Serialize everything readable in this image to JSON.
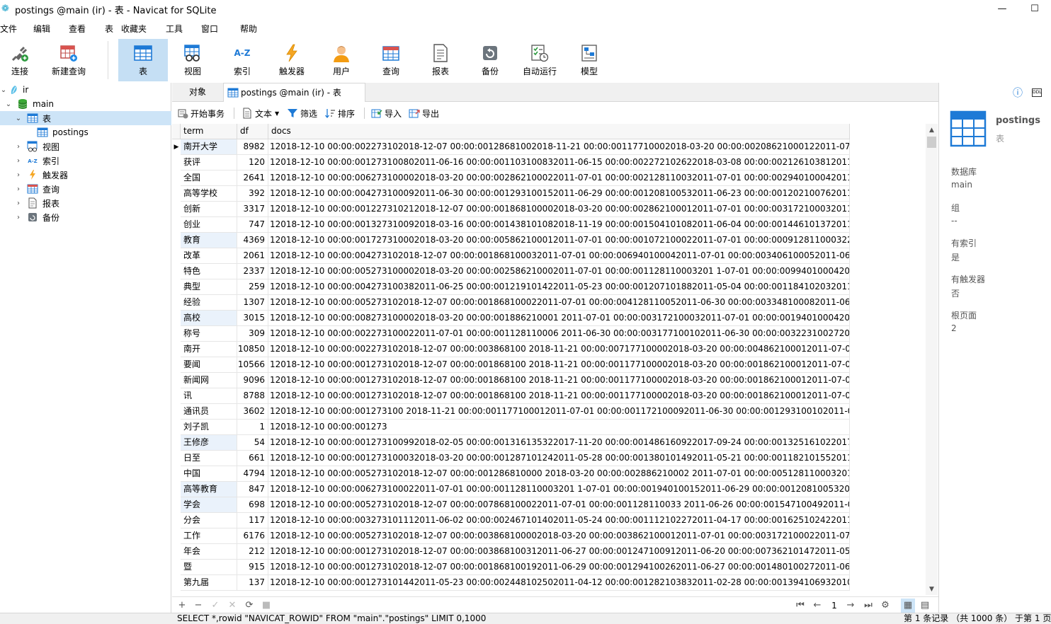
{
  "window": {
    "title": "postings @main (ir) - 表 - Navicat for SQLite",
    "minimize": "—",
    "maximize": "☐",
    "close": "✕"
  },
  "menu": [
    "文件",
    "编辑",
    "查看",
    "表",
    "收藏夹",
    "工具",
    "窗口",
    "帮助"
  ],
  "toolbar": {
    "items": [
      {
        "label": "连接",
        "icon": "connection-plug-icon"
      },
      {
        "label": "新建查询",
        "icon": "new-query-icon"
      },
      {
        "label": "表",
        "icon": "table-icon"
      },
      {
        "label": "视图",
        "icon": "view-glasses-icon"
      },
      {
        "label": "索引",
        "icon": "index-az-icon"
      },
      {
        "label": "触发器",
        "icon": "trigger-bolt-icon"
      },
      {
        "label": "用户",
        "icon": "user-icon"
      },
      {
        "label": "查询",
        "icon": "query-icon"
      },
      {
        "label": "报表",
        "icon": "report-icon"
      },
      {
        "label": "备份",
        "icon": "backup-icon"
      },
      {
        "label": "自动运行",
        "icon": "automation-icon"
      },
      {
        "label": "模型",
        "icon": "model-icon"
      }
    ]
  },
  "navigator": {
    "items": [
      {
        "label": "ir",
        "level": 0,
        "expanded": true
      },
      {
        "label": "main",
        "level": 1,
        "expanded": true
      },
      {
        "label": "表",
        "level": 2,
        "expanded": true,
        "selected": true
      },
      {
        "label": "postings",
        "level": 3
      },
      {
        "label": "视图",
        "level": 2
      },
      {
        "label": "索引",
        "level": 2
      },
      {
        "label": "触发器",
        "level": 2
      },
      {
        "label": "查询",
        "level": 2
      },
      {
        "label": "报表",
        "level": 2
      },
      {
        "label": "备份",
        "level": 2
      }
    ]
  },
  "tabs": {
    "objects": "对象",
    "active": "postings @main (ir) - 表"
  },
  "objtoolbar": {
    "begin_transaction": "开始事务",
    "text": "文本",
    "filter": "筛选",
    "sort": "排序",
    "import": "导入",
    "export": "导出"
  },
  "grid": {
    "columns": [
      "term",
      "df",
      "docs"
    ],
    "rows": [
      {
        "term": "南开大学",
        "df": "8982",
        "docs": "12018-12-10 00:00:002273102018-12-07 00:00:00128681002018-11-21 00:00:00117710002018-03-20 00:00:00208621000122011-07-01 00:00:00"
      },
      {
        "term": "获评",
        "df": "120",
        "docs": "12018-12-10 00:00:001273100802011-06-16 00:00:001103100832011-06-15 00:00:002272102622018-03-08 00:00:002126103812011-03-01 00:0"
      },
      {
        "term": "全国",
        "df": "2641",
        "docs": "12018-12-10 00:00:006273100002018-03-20 00:00:002862100022011-07-01 00:00:002128110032011-07-01 00:00:002940100042011-07-01 00:"
      },
      {
        "term": "高等学校",
        "df": "392",
        "docs": "12018-12-10 00:00:004273100092011-06-30 00:00:001293100152011-06-29 00:00:001208100532011-06-23 00:00:001202100762011-06-17 00:"
      },
      {
        "term": "创新",
        "df": "3317",
        "docs": "12018-12-10 00:00:001227310212018-12-07 00:00:001868100002018-03-20 00:00:002862100012011-07-01 00:00:003172100032011-07-01 00:00:0"
      },
      {
        "term": "创业",
        "df": "747",
        "docs": "12018-12-10 00:00:001327310092018-03-16 00:00:001438101082018-11-19 00:00:001504101082011-06-04 00:00:001446101372011-05-25 00:00"
      },
      {
        "term": "教育",
        "df": "4369",
        "docs": "12018-12-10 00:00:001727310002018-03-20 00:00:005862100012011-07-01 00:00:001072100022011-07-01 00:00:000912811000322011-07-01 0"
      },
      {
        "term": "改革",
        "df": "2061",
        "docs": "12018-12-10 00:00:004273102018-12-07 00:00:001868100032011-07-01 00:00:006940100042011-07-01 00:00:003406100052011-06-30 00:00:0"
      },
      {
        "term": "特色",
        "df": "2337",
        "docs": "12018-12-10 00:00:005273100002018-03-20 00:00:002586210002011-07-01 00:00:001128110003201 1-07-01 00:00:009940100042011-07-01 00"
      },
      {
        "term": "典型",
        "df": "259",
        "docs": "12018-12-10 00:00:004273100382011-06-25 00:00:001219101422011-05-23 00:00:001207101882011-05-04 00:00:001184102032011-04-26 00:"
      },
      {
        "term": "经验",
        "df": "1307",
        "docs": "12018-12-10 00:00:005273102018-12-07 00:00:001868100022011-07-01 00:00:004128110052011-06-30 00:00:003348100082011-06-30 00:00"
      },
      {
        "term": "高校",
        "df": "3015",
        "docs": "12018-12-10 00:00:008273100002018-03-20 00:00:001886210001 2011-07-01 00:00:003172100032011-07-01 00:00:001940100042011-07-01 00:"
      },
      {
        "term": "称号",
        "df": "309",
        "docs": "12018-12-10 00:00:002273100022011-07-01 00:00:001128110006 2011-06-30 00:00:003177100102011-06-30 00:00:003223100272011-06-27 00"
      },
      {
        "term": "南开",
        "df": "10850",
        "docs": "12018-12-10 00:00:002273102018-12-07 00:00:003868100 2018-11-21 00:00:007177100002018-03-20 00:00:004862100012011-07-01 00:00:0031"
      },
      {
        "term": "要闻",
        "df": "10566",
        "docs": "12018-12-10 00:00:001273102018-12-07 00:00:001868100 2018-11-21 00:00:001177100002018-03-20 00:00:001862100012011-07-01 00:00:0011"
      },
      {
        "term": "新闻网",
        "df": "9096",
        "docs": "12018-12-10 00:00:001273102018-12-07 00:00:001868100 2018-11-21 00:00:001177100002018-03-20 00:00:001862100012011-07-01 00:00:0011"
      },
      {
        "term": "讯",
        "df": "8788",
        "docs": "12018-12-10 00:00:001273102018-12-07 00:00:001868100 2018-11-21 00:00:001177100002018-03-20 00:00:001862100012011-07-01 00:00:0011"
      },
      {
        "term": "通讯员",
        "df": "3602",
        "docs": "12018-12-10 00:00:001273100 2018-11-21 00:00:001177100012011-07-01 00:00:001172100092011-06-30 00:00:001293100102011-06-30 00:00"
      },
      {
        "term": "刘子凯",
        "df": "1",
        "docs": "12018-12-10 00:00:001273"
      },
      {
        "term": "王修彦",
        "df": "54",
        "docs": "12018-12-10 00:00:001273100992018-02-05 00:00:001316135322017-11-20 00:00:001486160922017-09-24 00:00:001325161022017-09-24 00:00:00"
      },
      {
        "term": "日至",
        "df": "661",
        "docs": "12018-12-10 00:00:001273100032018-03-20 00:00:001287101242011-05-28 00:00:001380101492011-05-21 00:00:001182101552011-05-18 00:0"
      },
      {
        "term": "中国",
        "df": "4794",
        "docs": "12018-12-10 00:00:005273102018-12-07 00:00:001286810000 2018-03-20 00:00:002886210002 2011-07-01 00:00:005128110003201 1-07-01 00:0"
      },
      {
        "term": "高等教育",
        "df": "847",
        "docs": "12018-12-10 00:00:006273100022011-07-01 00:00:001128110003201 1-07-01 00:00:001940100152011-06-29 00:00:001208100532011-06-23 00"
      },
      {
        "term": "学会",
        "df": "698",
        "docs": "12018-12-10 00:00:005273102018-12-07 00:00:007868100022011-07-01 00:00:001128110033 2011-06-26 00:00:001547100492011-06-24 00:00"
      },
      {
        "term": "分会",
        "df": "117",
        "docs": "12018-12-10 00:00:003273101112011-06-02 00:00:002467101402011-05-24 00:00:001112102272011-04-17 00:00:001625102422011-04-14 00:"
      },
      {
        "term": "工作",
        "df": "6176",
        "docs": "12018-12-10 00:00:005273102018-12-07 00:00:003868100002018-03-20 00:00:003862100012011-07-01 00:00:003172100022011-07-01 00:00:0"
      },
      {
        "term": "年会",
        "df": "212",
        "docs": "12018-12-10 00:00:001273102018-12-07 00:00:003868100312011-06-27 00:00:001247100912011-06-20 00:00:007362101472011-05-21 00:00:0"
      },
      {
        "term": "暨",
        "df": "915",
        "docs": "12018-12-10 00:00:001273102018-12-07 00:00:001868100192011-06-29 00:00:001294100262011-06-27 00:00:001480100272011-06-27 00:00:0"
      },
      {
        "term": "第九届",
        "df": "137",
        "docs": "12018-12-10 00:00:001273101442011-05-23 00:00:002448102502011-04-12 00:00:001282103832011-02-28 00:00:001394106932010-10-22 00:"
      }
    ]
  },
  "pager": {
    "page": "1"
  },
  "info": {
    "name": "postings",
    "type": "表",
    "fields": [
      {
        "label": "数据库",
        "value": "main"
      },
      {
        "label": "组",
        "value": "--"
      },
      {
        "label": "有索引",
        "value": "是"
      },
      {
        "label": "有触发器",
        "value": "否"
      },
      {
        "label": "根页面",
        "value": "2"
      }
    ]
  },
  "status": {
    "sql": "SELECT *,rowid \"NAVICAT_ROWID\" FROM \"main\".\"postings\" LIMIT 0,1000",
    "records": "第 1 条记录 （共 1000 条） 于第 1 页"
  },
  "colors": {
    "accent": "#1e7ad6",
    "selected_bg": "#c5dff4",
    "grid_line": "#e6e6e6"
  }
}
